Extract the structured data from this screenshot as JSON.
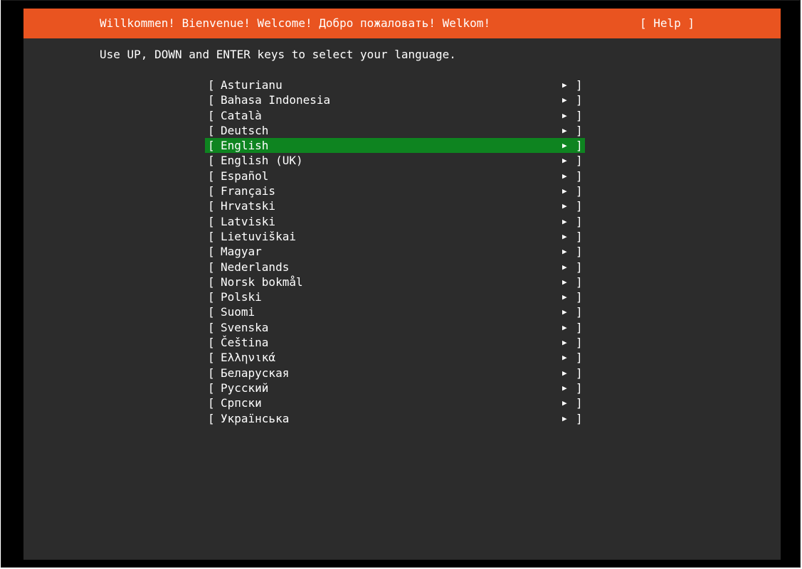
{
  "header": {
    "title": "Willkommen! Bienvenue! Welcome! Добро пожаловать! Welkom!",
    "help_label": "[ Help ]",
    "color": "#e95420"
  },
  "instruction": "Use UP, DOWN and ENTER keys to select your language.",
  "languages": {
    "open_bracket": "[",
    "close_bracket": "]",
    "arrow_glyph": "▶",
    "selected_color": "#0e8420",
    "selected": "English",
    "items": [
      "Asturianu",
      "Bahasa Indonesia",
      "Català",
      "Deutsch",
      "English",
      "English (UK)",
      "Español",
      "Français",
      "Hrvatski",
      "Latviski",
      "Lietuviškai",
      "Magyar",
      "Nederlands",
      "Norsk bokmål",
      "Polski",
      "Suomi",
      "Svenska",
      "Čeština",
      "Ελληνικά",
      "Беларуская",
      "Русский",
      "Српски",
      "Українська"
    ]
  }
}
